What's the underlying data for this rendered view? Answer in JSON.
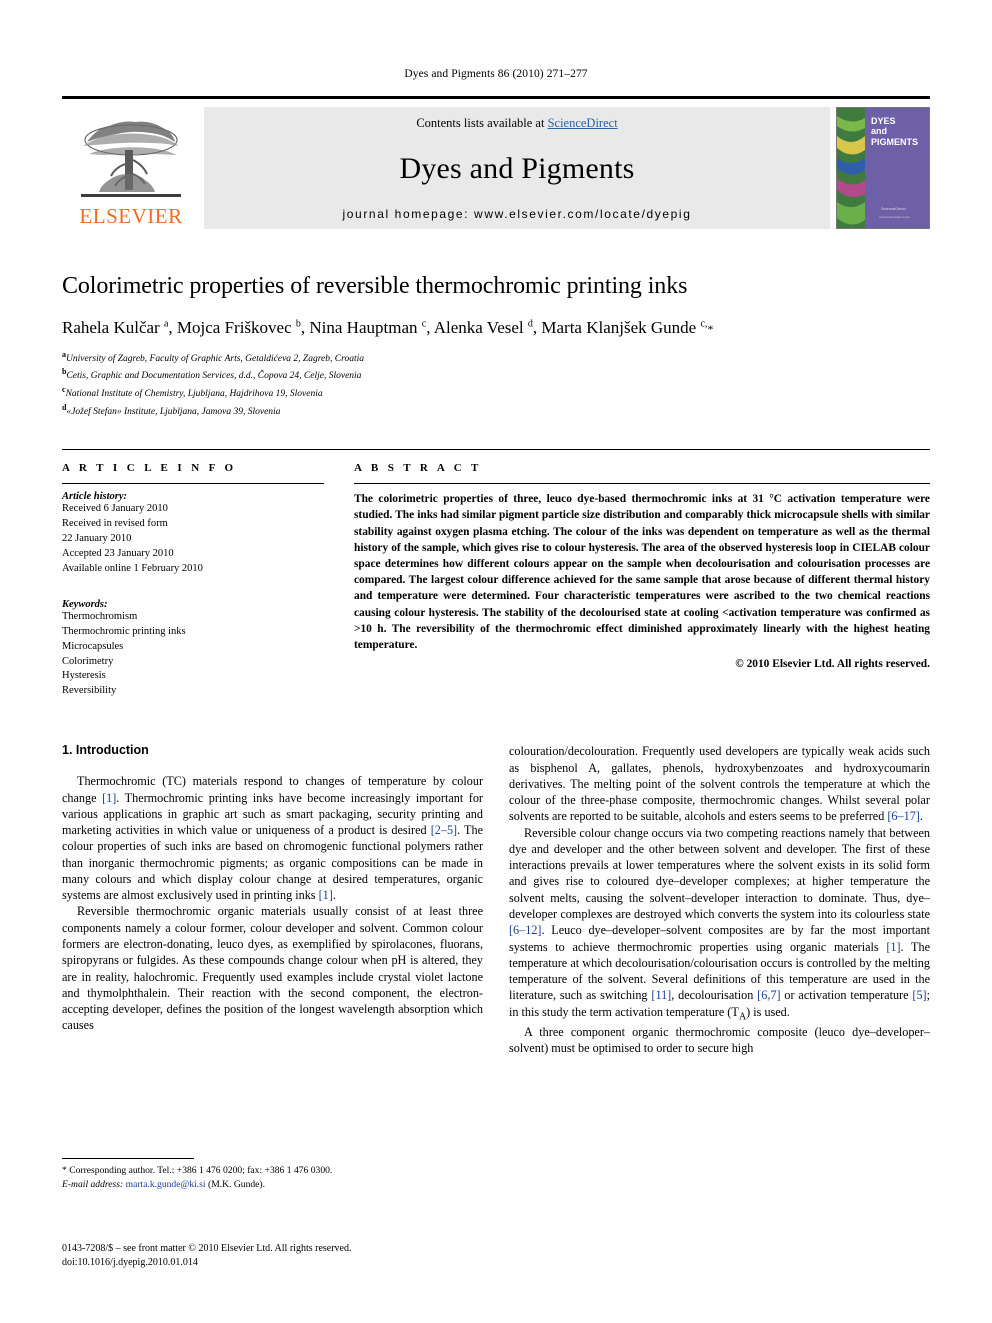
{
  "running_head": "Dyes and Pigments 86 (2010) 271–277",
  "masthead": {
    "publisher_name": "ELSEVIER",
    "contents_prefix": "Contents lists available at ",
    "contents_link": "ScienceDirect",
    "journal_name": "Dyes and Pigments",
    "homepage_line": "journal homepage: www.elsevier.com/locate/dyepig",
    "cover_title_line1": "DYES",
    "cover_title_line2": "and",
    "cover_title_line3": "PIGMENTS",
    "cover_footer": "ScienceDirect",
    "link_color": "#2763a8",
    "elsevier_orange": "#F26B21"
  },
  "article": {
    "title": "Colorimetric properties of reversible thermochromic printing inks",
    "authors_html": "Rahela Kulčar <sup>a</sup>, Mojca Friškovec <sup>b</sup>, Nina Hauptman <sup>c</sup>, Alenka Vesel <sup>d</sup>, Marta Klanjšek Gunde <sup>c,</sup><span class=\"star\">*</span>",
    "affiliations": [
      {
        "mark": "a",
        "text": "University of Zagreb, Faculty of Graphic Arts, Getaldićeva 2, Zagreb, Croatia"
      },
      {
        "mark": "b",
        "text": "Cetis, Graphic and Documentation Services, d.d., Čopova 24, Celje, Slovenia"
      },
      {
        "mark": "c",
        "text": "National Institute of Chemistry, Ljubljana, Hajdrihova 19, Slovenia"
      },
      {
        "mark": "d",
        "text": "«Jožef Stefan» Institute, Ljubljana, Jamova 39, Slovenia"
      }
    ]
  },
  "article_info": {
    "heading": "A R T I C L E   I N F O",
    "history_label": "Article history:",
    "history": [
      "Received 6 January 2010",
      "Received in revised form",
      "22 January 2010",
      "Accepted 23 January 2010",
      "Available online 1 February 2010"
    ],
    "keywords_label": "Keywords:",
    "keywords": [
      "Thermochromism",
      "Thermochromic printing inks",
      "Microcapsules",
      "Colorimetry",
      "Hysteresis",
      "Reversibility"
    ]
  },
  "abstract": {
    "heading": "A B S T R A C T",
    "text": "The colorimetric properties of three, leuco dye-based thermochromic inks at 31 °C activation temperature were studied. The inks had similar pigment particle size distribution and comparably thick microcapsule shells with similar stability against oxygen plasma etching. The colour of the inks was dependent on temperature as well as the thermal history of the sample, which gives rise to colour hysteresis. The area of the observed hysteresis loop in CIELAB colour space determines how different colours appear on the sample when decolourisation and colourisation processes are compared. The largest colour difference achieved for the same sample that arose because of different thermal history and temperature were determined. Four characteristic temperatures were ascribed to the two chemical reactions causing colour hysteresis. The stability of the decolourised state at cooling <activation temperature was confirmed as >10 h. The reversibility of the thermochromic effect diminished approximately linearly with the highest heating temperature.",
    "copyright": "© 2010 Elsevier Ltd. All rights reserved."
  },
  "introduction": {
    "heading": "1. Introduction",
    "left_paragraphs": [
      "Thermochromic (TC) materials respond to changes of temperature by colour change [1]. Thermochromic printing inks have become increasingly important for various applications in graphic art such as smart packaging, security printing and marketing activities in which value or uniqueness of a product is desired [2–5]. The colour properties of such inks are based on chromogenic functional polymers rather than inorganic thermochromic pigments; as organic compositions can be made in many colours and which display colour change at desired temperatures, organic systems are almost exclusively used in printing inks [1].",
      "Reversible thermochromic organic materials usually consist of at least three components namely a colour former, colour developer and solvent. Common colour formers are electron-donating, leuco dyes, as exemplified by spirolacones, fluorans, spiropyrans or fulgides. As these compounds change colour when pH is altered, they are in reality, halochromic. Frequently used examples include crystal violet lactone and thymolphthalein. Their reaction with the second component, the electron-accepting developer, defines the position of the longest wavelength absorption which causes"
    ],
    "right_paragraphs": [
      "colouration/decolouration. Frequently used developers are typically weak acids such as bisphenol A, gallates, phenols, hydroxybenzoates and hydroxycoumarin derivatives. The melting point of the solvent controls the temperature at which the colour of the three-phase composite, thermochromic changes. Whilst several polar solvents are reported to be suitable, alcohols and esters seems to be preferred [6–17].",
      "Reversible colour change occurs via two competing reactions namely that between dye and developer and the other between solvent and developer. The first of these interactions prevails at lower temperatures where the solvent exists in its solid form and gives rise to coloured dye–developer complexes; at higher temperature the solvent melts, causing the solvent–developer interaction to dominate. Thus, dye–developer complexes are destroyed which converts the system into its colourless state [6–12]. Leuco dye–developer–solvent composites are by far the most important systems to achieve thermochromic properties using organic materials [1]. The temperature at which decolourisation/colourisation occurs is controlled by the melting temperature of the solvent. Several definitions of this temperature are used in the literature, such as switching [11], decolourisation [6,7] or activation temperature [5]; in this study the term activation temperature (T<sub>A</sub>) is used.",
      "A three component organic thermochromic composite (leuco dye–developer–solvent) must be optimised to order to secure high"
    ]
  },
  "footnote": {
    "corresponding": "* Corresponding author. Tel.: +386 1 476 0200; fax: +386 1 476 0300.",
    "email_label": "E-mail address:",
    "email": "marta.k.gunde@ki.si",
    "email_suffix": "(M.K. Gunde).",
    "link_color": "#1b3f94"
  },
  "colophon": {
    "line1": "0143-7208/$ – see front matter © 2010 Elsevier Ltd. All rights reserved.",
    "line2": "doi:10.1016/j.dyepig.2010.01.014"
  }
}
